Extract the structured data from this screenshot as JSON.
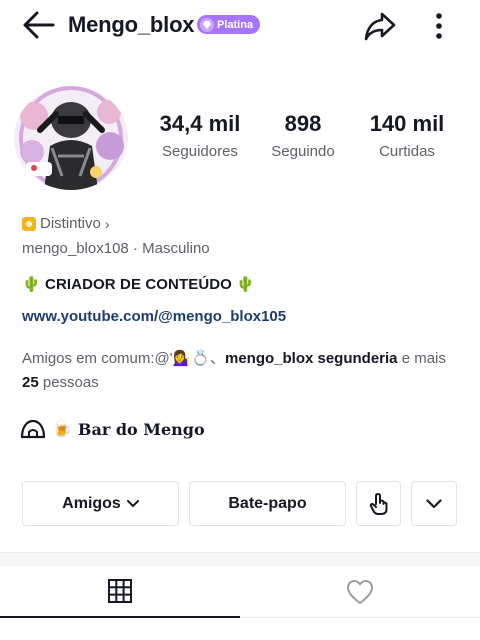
{
  "header": {
    "username": "Mengo_blox",
    "plan_badge": "Platina"
  },
  "stats": [
    {
      "value": "34,4 mil",
      "label": "Seguidores"
    },
    {
      "value": "898",
      "label": "Seguindo"
    },
    {
      "value": "140 mil",
      "label": "Curtidas"
    }
  ],
  "profile": {
    "badge_label": "Distintivo",
    "handle": "mengo_blox108",
    "gender": "Masculino",
    "bio_title": "🌵 CRIADOR DE CONTEÚDO 🌵",
    "link": "www.youtube.com/@mengo_blox105",
    "mutuals_prefix": "Amigos em comum:@'💁‍♀️💍、",
    "mutual_names": "mengo_blox segunderia",
    "mutuals_mid": " e mais ",
    "mutuals_count": "25",
    "mutuals_suffix": " pessoas",
    "shop_emoji": "🍺",
    "shop_name": "Bar do Mengo"
  },
  "actions": {
    "friends_label": "Amigos",
    "chat_label": "Bate-papo"
  },
  "tabs": [
    {
      "icon": "grid-icon",
      "selected": true
    },
    {
      "icon": "heart-outline-icon",
      "selected": false
    }
  ],
  "colors": {
    "accent_badge": "#a774ff",
    "link": "#1e3e6b",
    "secondary_text": "#5f6068",
    "badge_gold": "#f2b31b"
  }
}
